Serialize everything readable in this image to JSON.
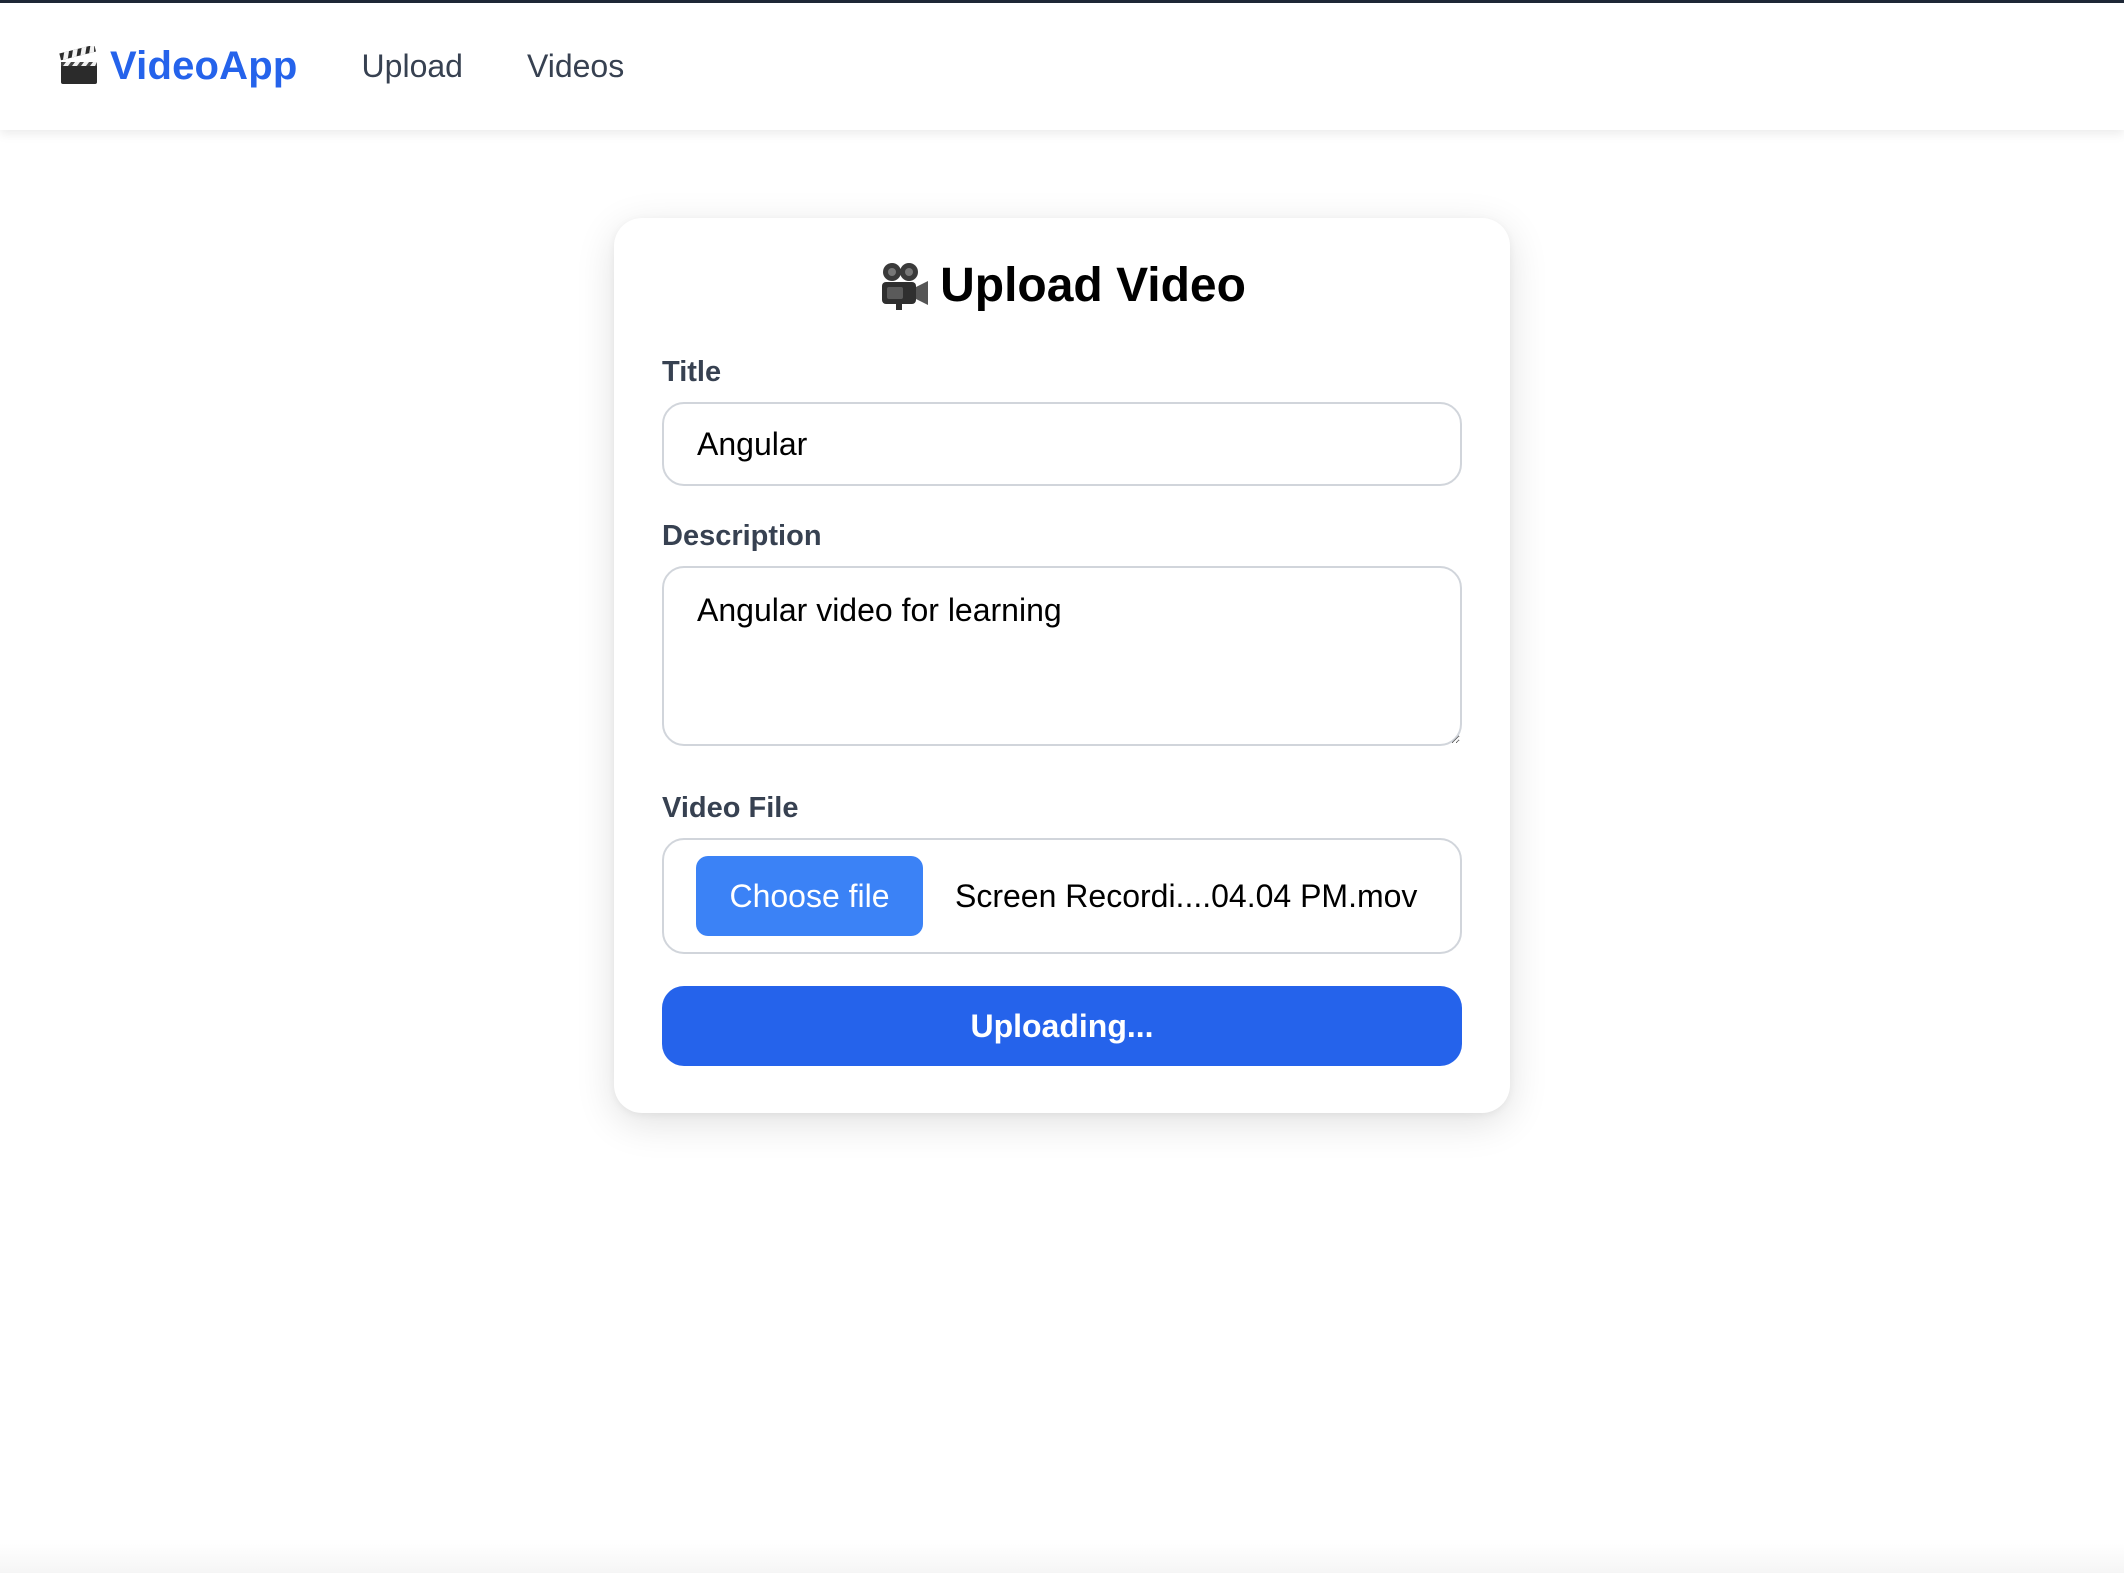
{
  "navbar": {
    "brand": "VideoApp",
    "brand_icon": "clapper-board-icon",
    "links": [
      "Upload",
      "Videos"
    ]
  },
  "form": {
    "heading": "Upload Video",
    "heading_icon": "movie-camera-icon",
    "title_label": "Title",
    "title_value": "Angular",
    "description_label": "Description",
    "description_value": "Angular video for learning",
    "file_label": "Video File",
    "choose_button": "Choose file",
    "file_name": "Screen Recordi....04.04 PM.mov",
    "submit_button": "Uploading..."
  },
  "colors": {
    "brand": "#2563eb",
    "choose_button": "#3b82f6",
    "submit_button": "#2563eb"
  }
}
